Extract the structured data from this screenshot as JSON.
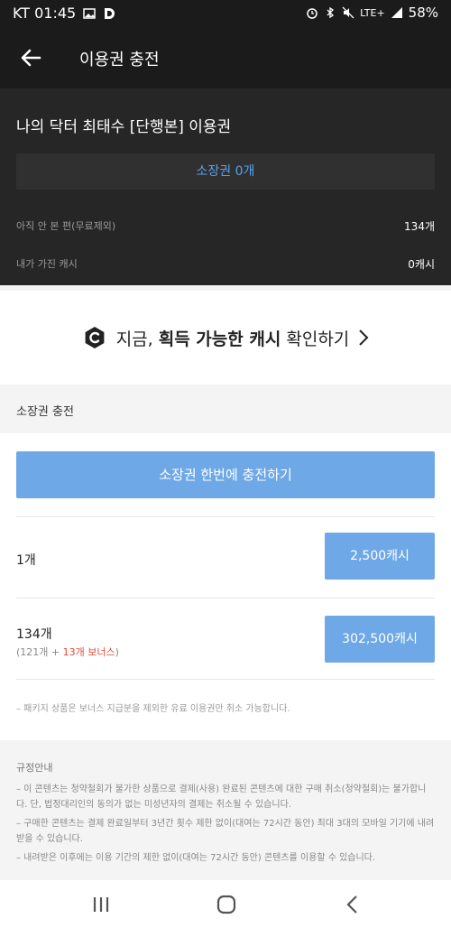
{
  "status_bar": {
    "carrier_time": "KT 01:45",
    "battery": "58%",
    "network": "LTE+"
  },
  "app_bar": {
    "title": "이용권 충전"
  },
  "summary": {
    "series_title": "나의 닥터 최태수 [단행본] 이용권",
    "owned_tickets": "소장권 0개",
    "unread_label": "아직 안 본 편(무료제외)",
    "unread_value": "134개",
    "cash_label": "내가 가진 캐시",
    "cash_value": "0캐시"
  },
  "cash_banner": {
    "text_prefix": "지금, ",
    "text_bold": "획득 가능한 캐시",
    "text_suffix": " 확인하기"
  },
  "purchase": {
    "section_title": "소장권 충전",
    "bulk_button": "소장권 한번에 충전하기",
    "packages": [
      {
        "quantity": "1개",
        "price": "2,500캐시"
      },
      {
        "quantity": "134개",
        "bonus_prefix": "(121개 + ",
        "bonus_red": "13개 보너스",
        "bonus_suffix": ")",
        "price": "302,500캐시"
      }
    ],
    "note": "– 패키지 상품은 보너스 지급분을 제외한 유료 이용권만 취소 가능합니다."
  },
  "rules": {
    "title": "규정안내",
    "items": [
      "– 이 콘텐츠는 청약철회가 불가한 상품으로 결제(사용) 완료된 콘텐츠에 대한 구매 취소(청약철회)는 불가합니다. 단, 법정대리인의 동의가 없는 미성년자의 결제는 취소될 수 있습니다.",
      "– 구매한 콘텐츠는 결제 완료일부터 3년간 횟수 제한 없이(대여는 72시간 동안) 최대 3대의 모바일 기기에 내려받을 수 있습니다.",
      "– 내려받은 이후에는 이용 기간의 제한 없이(대여는 72시간 동안) 콘텐츠를 이용할 수 있습니다."
    ]
  },
  "colors": {
    "dark_bg": "#1b1b1b",
    "panel_bg": "#262626",
    "accent_blue": "#6ea8e6",
    "link_blue": "#5aa2ea",
    "bonus_red": "#e24a3b"
  }
}
